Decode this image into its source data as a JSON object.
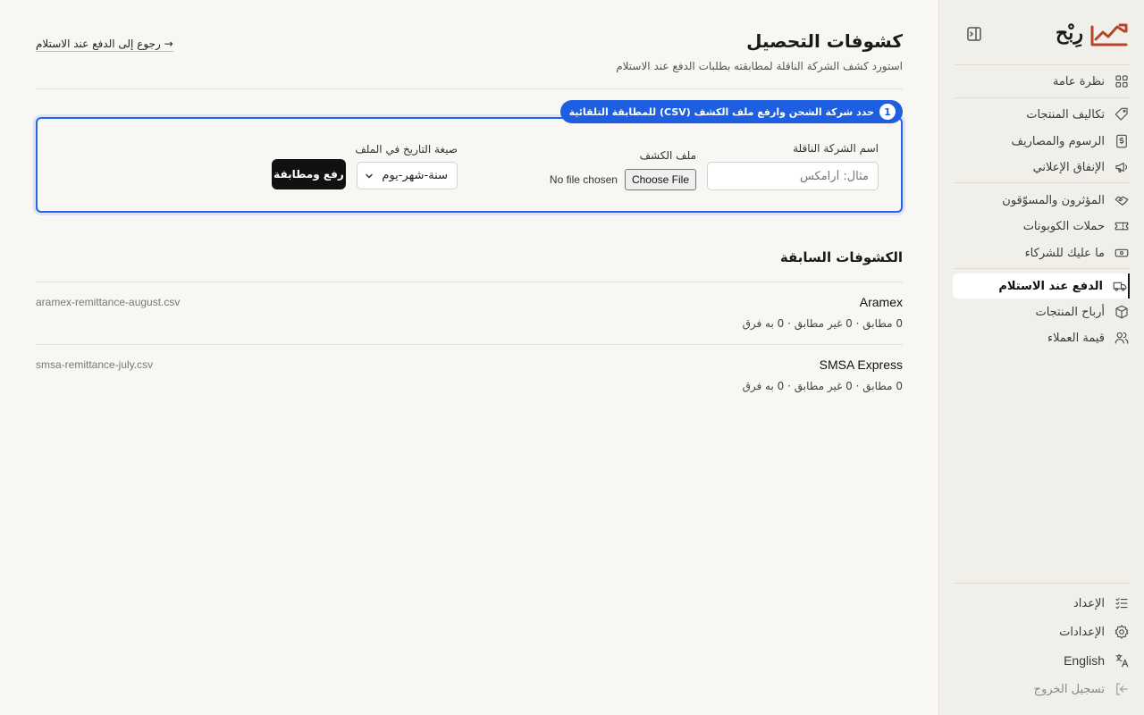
{
  "brand": {
    "name": "رِبْح",
    "accent": "#b5462b"
  },
  "sidebar": {
    "collapse_icon": "sidebar-collapse-icon",
    "groups": [
      [
        {
          "label": "نظرة عامة",
          "icon": "grid-icon"
        }
      ],
      [
        {
          "label": "تكاليف المنتجات",
          "icon": "tag-icon"
        },
        {
          "label": "الرسوم والمصاريف",
          "icon": "dollar-receipt-icon"
        },
        {
          "label": "الإنفاق الإعلاني",
          "icon": "megaphone-icon"
        }
      ],
      [
        {
          "label": "المؤثرون والمسوّقون",
          "icon": "handshake-icon"
        },
        {
          "label": "حملات الكوبونات",
          "icon": "ticket-icon"
        },
        {
          "label": "ما عليك للشركاء",
          "icon": "banknote-icon"
        }
      ],
      [
        {
          "label": "الدفع عند الاستلام",
          "icon": "truck-icon",
          "active": true
        },
        {
          "label": "أرباح المنتجات",
          "icon": "box-icon"
        },
        {
          "label": "قيمة العملاء",
          "icon": "users-icon"
        }
      ]
    ],
    "footer": [
      {
        "label": "الإعداد",
        "icon": "checklist-icon"
      },
      {
        "label": "الإعدادات",
        "icon": "gear-icon"
      },
      {
        "label": "English",
        "icon": "translate-icon"
      },
      {
        "label": "تسجيل الخروج",
        "icon": "logout-icon"
      }
    ]
  },
  "header": {
    "title": "كشوفات التحصيل",
    "subtitle": "استورد كشف الشركة الناقلة لمطابقته بطلبات الدفع عند الاستلام",
    "back_link": "→ رجوع إلى الدفع عند الاستلام"
  },
  "upload": {
    "step_number": "1",
    "step_text": "حدد شركة الشحن وارفع ملف الكشف (CSV) للمطابقة التلقائية",
    "carrier_label": "اسم الشركة الناقلة",
    "carrier_placeholder": "مثال: أرامكس",
    "file_label": "ملف الكشف",
    "choose_file": "Choose File",
    "no_file": "No file chosen",
    "date_format_label": "صيغة التاريخ في الملف",
    "date_format_value": "سنة-شهر-يوم",
    "upload_button": "رفع ومطابقة",
    "highlight_color": "#2563eb"
  },
  "previous": {
    "title": "الكشوفات السابقة",
    "rows": [
      {
        "carrier": "Aramex",
        "stats": "0 مطابق · 0 غير مطابق · 0 به فرق",
        "file": "aramex-remittance-august.csv"
      },
      {
        "carrier": "SMSA Express",
        "stats": "0 مطابق · 0 غير مطابق · 0 به فرق",
        "file": "smsa-remittance-july.csv"
      }
    ]
  }
}
